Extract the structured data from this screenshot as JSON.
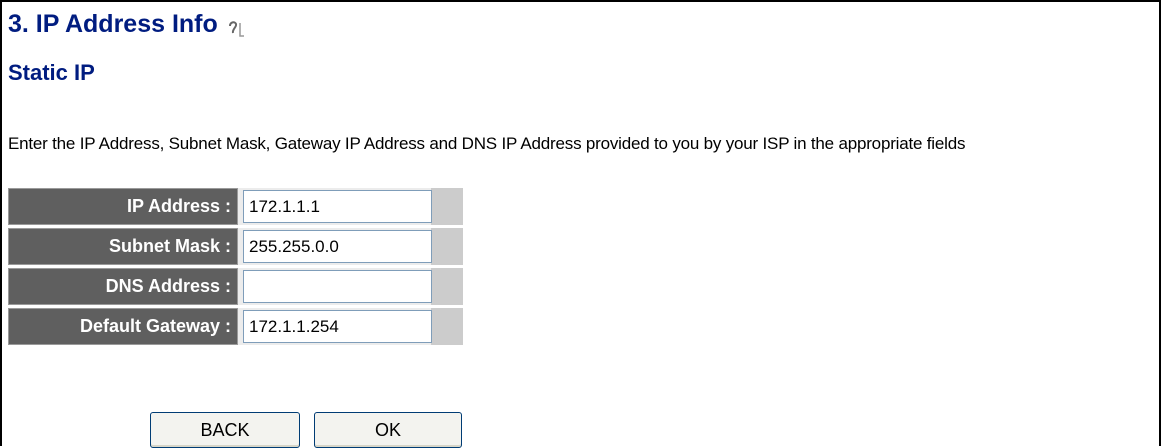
{
  "header": {
    "title": "3. IP Address Info",
    "subtitle": "Static IP"
  },
  "description": "Enter the IP Address, Subnet Mask, Gateway IP Address and DNS IP Address provided to you by your ISP in the appropriate fields",
  "form": {
    "ip_address": {
      "label": "IP Address :",
      "value": "172.1.1.1"
    },
    "subnet_mask": {
      "label": "Subnet Mask :",
      "value": "255.255.0.0"
    },
    "dns_address": {
      "label": "DNS Address :",
      "value": ""
    },
    "default_gateway": {
      "label": "Default Gateway :",
      "value": "172.1.1.254"
    }
  },
  "buttons": {
    "back_label": "BACK",
    "ok_label": "OK"
  },
  "icons": {
    "help": "help-icon"
  },
  "colors": {
    "heading": "#001c80",
    "label_bg": "#5f5f5f",
    "row_bg": "#ececec"
  }
}
